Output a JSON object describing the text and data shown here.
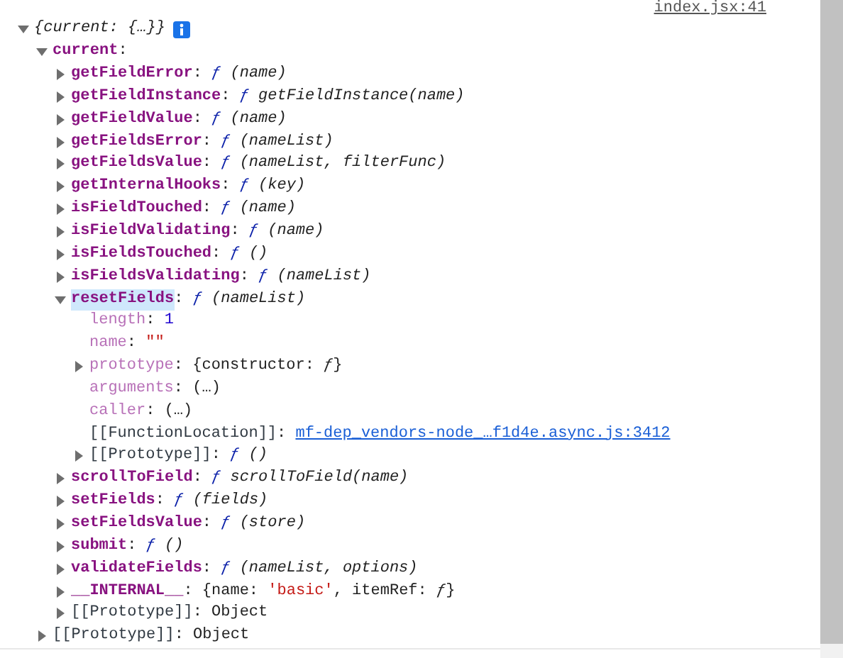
{
  "source_link": "index.jsx:41",
  "tree": [
    {
      "expanded": true,
      "selected": false,
      "value": [
        {
          "text": "{current: {…}}",
          "kind": "italic"
        }
      ],
      "info": true,
      "children": [
        {
          "key": "current",
          "kind": "own",
          "sep": ":",
          "expanded": true,
          "selected": false,
          "children": [
            {
              "key": "getFieldError",
              "kind": "own",
              "sep": ":",
              "expanded": false,
              "selected": false,
              "value": [
                {
                  "text": "ƒ",
                  "kind": "fn"
                },
                {
                  "text": " (name)",
                  "kind": "italic"
                }
              ]
            },
            {
              "key": "getFieldInstance",
              "kind": "own",
              "sep": ":",
              "expanded": false,
              "selected": false,
              "value": [
                {
                  "text": "ƒ",
                  "kind": "fn"
                },
                {
                  "text": " getFieldInstance(name)",
                  "kind": "italic"
                }
              ]
            },
            {
              "key": "getFieldValue",
              "kind": "own",
              "sep": ":",
              "expanded": false,
              "selected": false,
              "value": [
                {
                  "text": "ƒ",
                  "kind": "fn"
                },
                {
                  "text": " (name)",
                  "kind": "italic"
                }
              ]
            },
            {
              "key": "getFieldsError",
              "kind": "own",
              "sep": ":",
              "expanded": false,
              "selected": false,
              "value": [
                {
                  "text": "ƒ",
                  "kind": "fn"
                },
                {
                  "text": " (nameList)",
                  "kind": "italic"
                }
              ]
            },
            {
              "key": "getFieldsValue",
              "kind": "own",
              "sep": ":",
              "expanded": false,
              "selected": false,
              "value": [
                {
                  "text": "ƒ",
                  "kind": "fn"
                },
                {
                  "text": " (nameList, filterFunc)",
                  "kind": "italic"
                }
              ]
            },
            {
              "key": "getInternalHooks",
              "kind": "own",
              "sep": ":",
              "expanded": false,
              "selected": false,
              "value": [
                {
                  "text": "ƒ",
                  "kind": "fn"
                },
                {
                  "text": " (key)",
                  "kind": "italic"
                }
              ]
            },
            {
              "key": "isFieldTouched",
              "kind": "own",
              "sep": ":",
              "expanded": false,
              "selected": false,
              "value": [
                {
                  "text": "ƒ",
                  "kind": "fn"
                },
                {
                  "text": " (name)",
                  "kind": "italic"
                }
              ]
            },
            {
              "key": "isFieldValidating",
              "kind": "own",
              "sep": ":",
              "expanded": false,
              "selected": false,
              "value": [
                {
                  "text": "ƒ",
                  "kind": "fn"
                },
                {
                  "text": " (name)",
                  "kind": "italic"
                }
              ]
            },
            {
              "key": "isFieldsTouched",
              "kind": "own",
              "sep": ":",
              "expanded": false,
              "selected": false,
              "value": [
                {
                  "text": "ƒ",
                  "kind": "fn"
                },
                {
                  "text": " ()",
                  "kind": "italic"
                }
              ]
            },
            {
              "key": "isFieldsValidating",
              "kind": "own",
              "sep": ":",
              "expanded": false,
              "selected": false,
              "value": [
                {
                  "text": "ƒ",
                  "kind": "fn"
                },
                {
                  "text": " (nameList)",
                  "kind": "italic"
                }
              ]
            },
            {
              "key": "resetFields",
              "kind": "own",
              "sep": ":",
              "expanded": true,
              "selected": true,
              "value": [
                {
                  "text": "ƒ",
                  "kind": "fn"
                },
                {
                  "text": " (nameList)",
                  "kind": "italic"
                }
              ],
              "children": [
                {
                  "key": "length",
                  "kind": "internal",
                  "sep": ":",
                  "selected": false,
                  "value": [
                    {
                      "text": "1",
                      "kind": "num"
                    }
                  ]
                },
                {
                  "key": "name",
                  "kind": "internal",
                  "sep": ":",
                  "selected": false,
                  "value": [
                    {
                      "text": "\"\"",
                      "kind": "str"
                    }
                  ]
                },
                {
                  "key": "prototype",
                  "kind": "internal",
                  "sep": ":",
                  "expanded": false,
                  "selected": false,
                  "value": [
                    {
                      "text": "{constructor: ",
                      "kind": "plain"
                    },
                    {
                      "text": "ƒ",
                      "kind": "italic"
                    },
                    {
                      "text": "}",
                      "kind": "plain"
                    }
                  ]
                },
                {
                  "key": "arguments",
                  "kind": "internal",
                  "sep": ":",
                  "selected": false,
                  "value": [
                    {
                      "text": " (…)",
                      "kind": "plain"
                    }
                  ]
                },
                {
                  "key": "caller",
                  "kind": "internal",
                  "sep": ":",
                  "selected": false,
                  "value": [
                    {
                      "text": " (…)",
                      "kind": "plain"
                    }
                  ]
                },
                {
                  "key": "[[FunctionLocation]]",
                  "kind": "meta",
                  "sep": ":",
                  "selected": false,
                  "value": [
                    {
                      "text": "mf-dep_vendors-node_…f1d4e.async.js:3412",
                      "kind": "link"
                    }
                  ]
                },
                {
                  "key": "[[Prototype]]",
                  "kind": "meta",
                  "sep": ":",
                  "expanded": false,
                  "selected": false,
                  "value": [
                    {
                      "text": "ƒ",
                      "kind": "fn"
                    },
                    {
                      "text": " ()",
                      "kind": "italic"
                    }
                  ]
                }
              ]
            },
            {
              "key": "scrollToField",
              "kind": "own",
              "sep": ":",
              "expanded": false,
              "selected": false,
              "value": [
                {
                  "text": "ƒ",
                  "kind": "fn"
                },
                {
                  "text": " scrollToField(name)",
                  "kind": "italic"
                }
              ]
            },
            {
              "key": "setFields",
              "kind": "own",
              "sep": ":",
              "expanded": false,
              "selected": false,
              "value": [
                {
                  "text": "ƒ",
                  "kind": "fn"
                },
                {
                  "text": " (fields)",
                  "kind": "italic"
                }
              ]
            },
            {
              "key": "setFieldsValue",
              "kind": "own",
              "sep": ":",
              "expanded": false,
              "selected": false,
              "value": [
                {
                  "text": "ƒ",
                  "kind": "fn"
                },
                {
                  "text": " (store)",
                  "kind": "italic"
                }
              ]
            },
            {
              "key": "submit",
              "kind": "own",
              "sep": ":",
              "expanded": false,
              "selected": false,
              "value": [
                {
                  "text": "ƒ",
                  "kind": "fn"
                },
                {
                  "text": " ()",
                  "kind": "italic"
                }
              ]
            },
            {
              "key": "validateFields",
              "kind": "own",
              "sep": ":",
              "expanded": false,
              "selected": false,
              "value": [
                {
                  "text": "ƒ",
                  "kind": "fn"
                },
                {
                  "text": " (nameList, options)",
                  "kind": "italic"
                }
              ]
            },
            {
              "key": "__INTERNAL__",
              "kind": "own",
              "sep": ":",
              "expanded": false,
              "selected": false,
              "value": [
                {
                  "text": "{name: ",
                  "kind": "plain"
                },
                {
                  "text": "'basic'",
                  "kind": "str"
                },
                {
                  "text": ", itemRef: ",
                  "kind": "plain"
                },
                {
                  "text": "ƒ",
                  "kind": "italic"
                },
                {
                  "text": "}",
                  "kind": "plain"
                }
              ]
            },
            {
              "key": "[[Prototype]]",
              "kind": "meta",
              "sep": ":",
              "expanded": false,
              "selected": false,
              "value": [
                {
                  "text": "Object",
                  "kind": "plain"
                }
              ]
            }
          ]
        },
        {
          "key": "[[Prototype]]",
          "kind": "meta",
          "sep": ":",
          "expanded": false,
          "selected": false,
          "value": [
            {
              "text": "Object",
              "kind": "plain"
            }
          ]
        }
      ]
    }
  ]
}
